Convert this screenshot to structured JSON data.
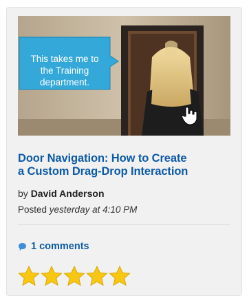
{
  "post": {
    "thumbnail_caption": [
      "This takes me to",
      "the Training",
      "department."
    ],
    "title_lines": [
      "Door Navigation: How to Create",
      "a Custom Drag-Drop Interaction"
    ],
    "by_label": "by",
    "author": "David Anderson",
    "posted_label": "Posted",
    "posted_when": "yesterday at 4:10 PM",
    "comments_label": "1 comments",
    "comment_icon": "speech-bubble-icon",
    "rating": 5,
    "rating_max": 5,
    "rating_icon": "star-icon"
  },
  "colors": {
    "link": "#0d5aa7",
    "bubble": "#34a8d9",
    "star": "#f7c713"
  }
}
